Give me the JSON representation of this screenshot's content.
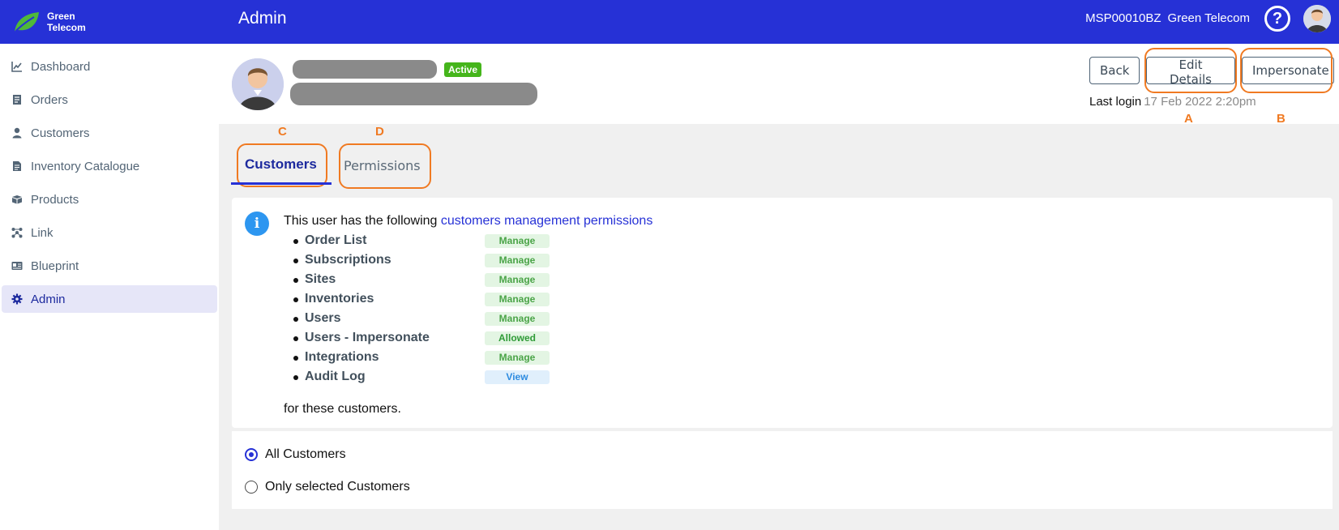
{
  "brand": {
    "line1": "Green",
    "line2": "Telecom",
    "logo_icon": "leaf-icon",
    "accent_color": "#2631d6"
  },
  "sidebar": {
    "items": [
      {
        "label": "Dashboard",
        "icon": "chart-line-icon"
      },
      {
        "label": "Orders",
        "icon": "receipt-icon"
      },
      {
        "label": "Customers",
        "icon": "user-icon"
      },
      {
        "label": "Inventory Catalogue",
        "icon": "document-icon"
      },
      {
        "label": "Products",
        "icon": "boxes-icon"
      },
      {
        "label": "Link",
        "icon": "network-icon"
      },
      {
        "label": "Blueprint",
        "icon": "id-card-icon"
      },
      {
        "label": "Admin",
        "icon": "gear-icon",
        "active": true
      }
    ]
  },
  "topbar": {
    "title": "Admin",
    "account_id": "MSP00010BZ",
    "account_name": "Green Telecom",
    "help_glyph": "?"
  },
  "user_header": {
    "status": "Active",
    "status_color": "#45b51b",
    "back_label": "Back",
    "edit_label": "Edit Details",
    "impersonate_label": "Impersonate",
    "last_login_label": "Last login",
    "last_login_value": "17 Feb 2022  2:20pm"
  },
  "markers": {
    "a": "A",
    "b": "B",
    "c": "C",
    "d": "D",
    "color": "#f07a22"
  },
  "tabs": {
    "customers": "Customers",
    "permissions": "Permissions",
    "active": "Customers"
  },
  "permissions_card": {
    "intro_text": "This user has the following",
    "intro_link": "customers management permissions",
    "info_glyph": "i",
    "items": [
      {
        "name": "Order List",
        "level": "Manage"
      },
      {
        "name": "Subscriptions",
        "level": "Manage"
      },
      {
        "name": "Sites",
        "level": "Manage"
      },
      {
        "name": "Inventories",
        "level": "Manage"
      },
      {
        "name": "Users",
        "level": "Manage"
      },
      {
        "name": "Users - Impersonate",
        "level": "Allowed"
      },
      {
        "name": "Integrations",
        "level": "Manage"
      },
      {
        "name": "Audit Log",
        "level": "View"
      }
    ],
    "outro_text": "for these customers."
  },
  "customer_scope": {
    "all_label": "All Customers",
    "selected_label": "Only selected Customers",
    "selected": "All Customers"
  }
}
